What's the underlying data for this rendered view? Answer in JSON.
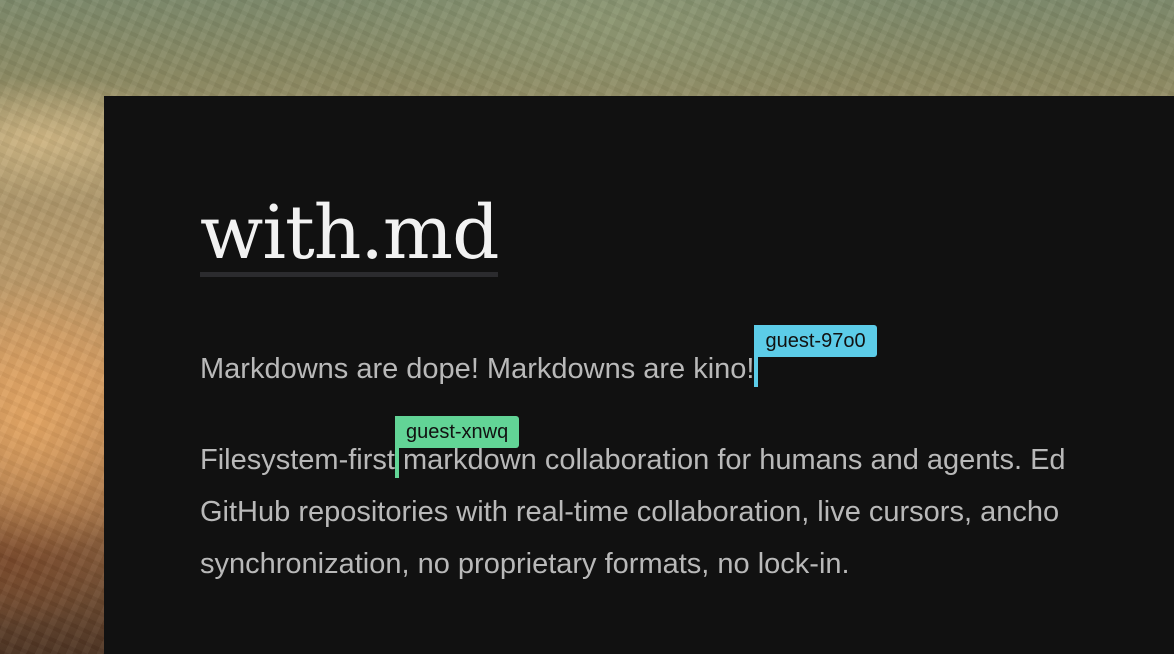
{
  "document": {
    "title": "with.md",
    "paragraph_1": "Markdowns are dope! Markdowns are kino!",
    "paragraph_2": {
      "line_1_before_cursor": "Filesystem-first",
      "line_1_after_cursor": " markdown collaboration for humans and agents. Ed",
      "line_2": "GitHub repositories with real-time collaboration, live cursors, ancho",
      "line_3": "synchronization, no proprietary formats, no lock-in."
    }
  },
  "cursors": [
    {
      "user": "guest-97o0",
      "color": "#5ccce8"
    },
    {
      "user": "guest-xnwq",
      "color": "#62d496"
    }
  ]
}
